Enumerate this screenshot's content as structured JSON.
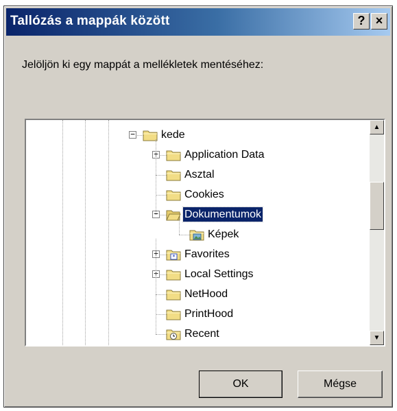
{
  "window": {
    "title": "Tallózás a mappák között",
    "help_label": "?",
    "close_label": "×"
  },
  "prompt": "Jelöljön ki egy mappát a mellékletek mentéséhez:",
  "tree": {
    "items": [
      {
        "label": "kede",
        "expander": "−",
        "icon": "folder-icon"
      },
      {
        "label": "Application Data",
        "expander": "+",
        "icon": "folder-icon"
      },
      {
        "label": "Asztal",
        "expander": "",
        "icon": "folder-icon"
      },
      {
        "label": "Cookies",
        "expander": "",
        "icon": "folder-icon"
      },
      {
        "label": "Dokumentumok",
        "expander": "−",
        "icon": "open-folder-icon",
        "selected": true
      },
      {
        "label": "Képek",
        "expander": "",
        "icon": "pictures-folder-icon"
      },
      {
        "label": "Favorites",
        "expander": "+",
        "icon": "favorites-folder-icon"
      },
      {
        "label": "Local Settings",
        "expander": "+",
        "icon": "folder-icon"
      },
      {
        "label": "NetHood",
        "expander": "",
        "icon": "folder-icon"
      },
      {
        "label": "PrintHood",
        "expander": "",
        "icon": "folder-icon"
      },
      {
        "label": "Recent",
        "expander": "",
        "icon": "recent-folder-icon"
      }
    ]
  },
  "scrollbar": {
    "up": "▲",
    "down": "▼"
  },
  "buttons": {
    "ok": "OK",
    "cancel": "Mégse"
  },
  "colors": {
    "titlebar": "#0a246a",
    "face": "#d4d0c8",
    "selection": "#0a246a",
    "folder": "#f2dd86"
  }
}
